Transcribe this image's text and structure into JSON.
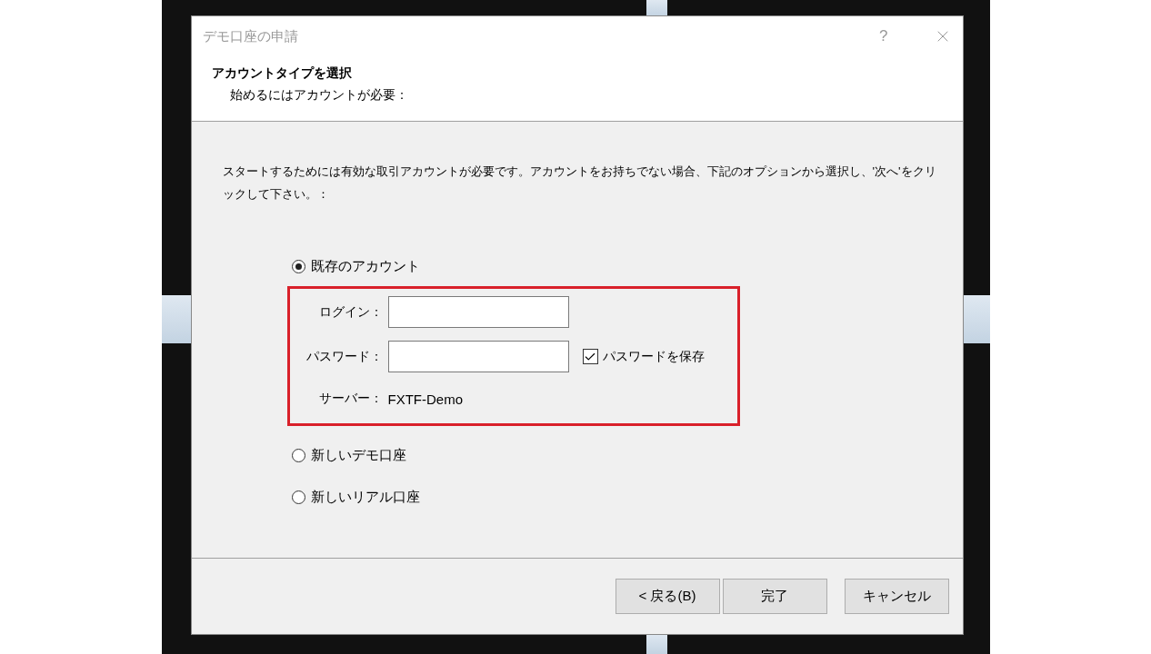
{
  "window": {
    "title": "デモ口座の申請",
    "help": "?"
  },
  "header": {
    "title": "アカウントタイプを選択",
    "subtitle": "始めるにはアカウントが必要："
  },
  "instruction": "スタートするためには有効な取引アカウントが必要です。アカウントをお持ちでない場合、下記のオプションから選択し、'次へ'をクリックして下さい。：",
  "options": [
    {
      "label": "既存のアカウント",
      "selected": true,
      "kind": "existing"
    },
    {
      "label": "新しいデモ口座",
      "selected": false,
      "kind": "plain"
    },
    {
      "label": "新しいリアル口座",
      "selected": false,
      "kind": "plain"
    }
  ],
  "account": {
    "login": {
      "label": "ログイン："
    },
    "password": {
      "label": "パスワード："
    },
    "remember": {
      "label": "パスワードを保存",
      "checked": true
    },
    "server": {
      "label": "サーバー：",
      "value": "FXTF-Demo"
    }
  },
  "buttons": [
    {
      "label": "< 戻る(B)"
    },
    {
      "label": "完了"
    },
    {
      "label": "キャンセル"
    }
  ]
}
